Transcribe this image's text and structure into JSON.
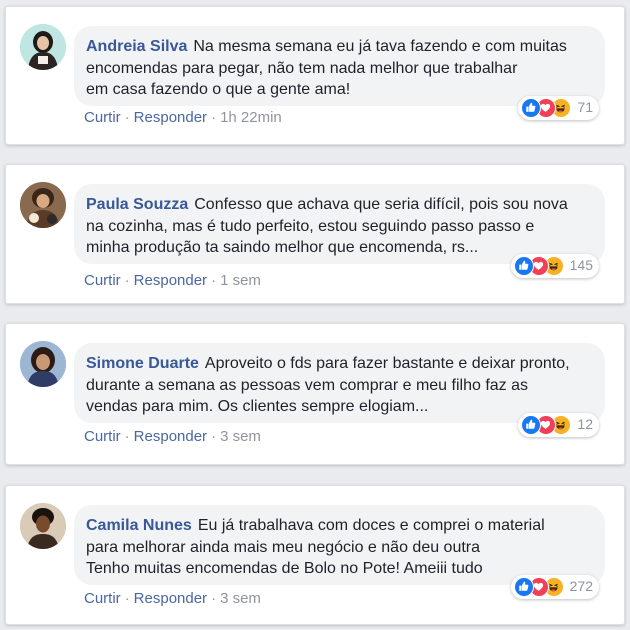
{
  "colors": {
    "page_background": "#e9ebee",
    "author_name": "#385898",
    "action_link": "#4b67a1",
    "meta_gray": "#90949c",
    "like_blue": "#1877f2",
    "love_red": "#f33e58",
    "haha_yellow": "#f7b125"
  },
  "comments": [
    {
      "author": "Andreia Silva",
      "lines": [
        "Na mesma semana eu já tava fazendo e com muitas",
        "encomendas para pegar, não tem nada melhor que trabalhar",
        "em casa fazendo o que a gente ama!"
      ],
      "reactions": [
        "like-icon",
        "love-icon",
        "haha-icon"
      ],
      "reaction_count": "71",
      "like_label": "Curtir",
      "separator": "·",
      "reply_label": "Responder",
      "time": "1h 22min"
    },
    {
      "author": "Paula Souzza",
      "lines": [
        "Confesso que achava que seria difícil, pois sou nova",
        "na cozinha, mas é tudo perfeito, estou seguindo passo passo e",
        "minha produção ta saindo melhor que encomenda, rs..."
      ],
      "reactions": [
        "like-icon",
        "love-icon",
        "haha-icon"
      ],
      "reaction_count": "145",
      "like_label": "Curtir",
      "separator": "·",
      "reply_label": "Responder",
      "time": "1 sem"
    },
    {
      "author": "Simone Duarte",
      "lines": [
        "Aproveito o fds para fazer bastante e deixar pronto,",
        "durante a semana as pessoas vem comprar e meu filho faz as",
        "vendas para mim. Os clientes sempre elogiam..."
      ],
      "reactions": [
        "like-icon",
        "love-icon",
        "haha-icon"
      ],
      "reaction_count": "12",
      "like_label": "Curtir",
      "separator": "·",
      "reply_label": "Responder",
      "time": "3 sem"
    },
    {
      "author": "Camila Nunes",
      "lines": [
        "Eu já trabalhava com doces e comprei o material",
        "para melhorar ainda mais meu negócio e não deu outra",
        "Tenho muitas encomendas de Bolo no Pote! Ameiii tudo"
      ],
      "reactions": [
        "like-icon",
        "love-icon",
        "haha-icon"
      ],
      "reaction_count": "272",
      "like_label": "Curtir",
      "separator": "·",
      "reply_label": "Responder",
      "time": "3 sem"
    }
  ]
}
